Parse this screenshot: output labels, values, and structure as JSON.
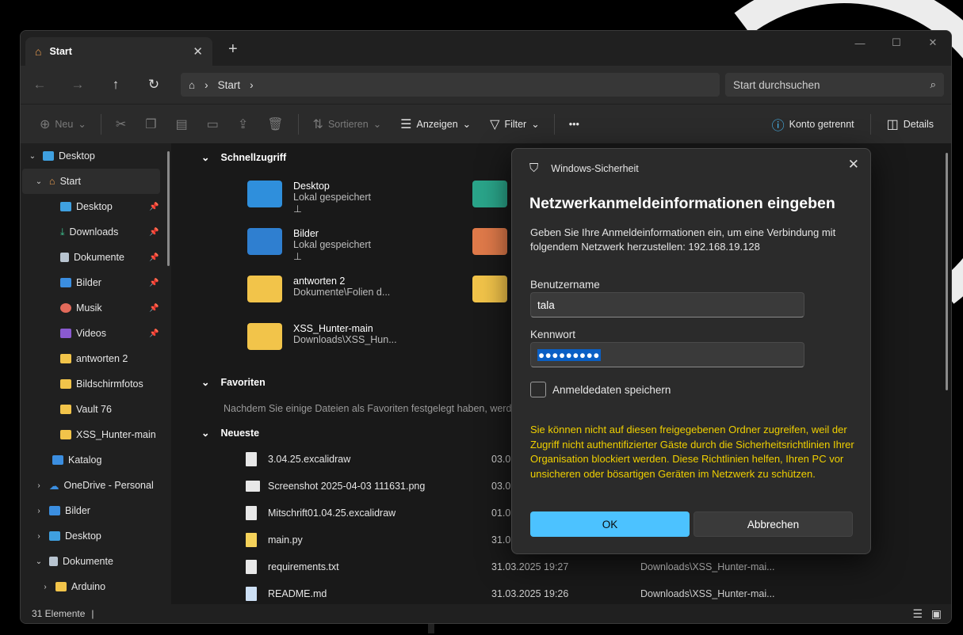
{
  "window": {
    "tab_title": "Start",
    "back_icon": "←",
    "forward_icon": "→",
    "up_icon": "↑",
    "refresh_icon": "↻",
    "breadcrumb": "Start",
    "search_placeholder": "Start durchsuchen"
  },
  "commands": {
    "new": "Neu",
    "sort": "Sortieren",
    "view": "Anzeigen",
    "filter": "Filter",
    "more": "•••",
    "account": "Konto getrennt",
    "details": "Details"
  },
  "sidebar": {
    "items": [
      {
        "label": "Desktop"
      },
      {
        "label": "Start"
      },
      {
        "label": "Desktop"
      },
      {
        "label": "Downloads"
      },
      {
        "label": "Dokumente"
      },
      {
        "label": "Bilder"
      },
      {
        "label": "Musik"
      },
      {
        "label": "Videos"
      },
      {
        "label": "antworten 2"
      },
      {
        "label": "Bildschirmfotos"
      },
      {
        "label": "Vault 76"
      },
      {
        "label": "XSS_Hunter-main"
      },
      {
        "label": "Katalog"
      },
      {
        "label": "OneDrive - Personal"
      },
      {
        "label": "Bilder"
      },
      {
        "label": "Desktop"
      },
      {
        "label": "Dokumente"
      },
      {
        "label": "Arduino"
      }
    ]
  },
  "sections": {
    "quick": "Schnellzugriff",
    "favorites": "Favoriten",
    "favorites_hint": "Nachdem Sie einige Dateien als Favoriten festgelegt haben, werden s",
    "recent": "Neueste"
  },
  "quick_access": [
    {
      "name": "Desktop",
      "sub": "Lokal gespeichert"
    },
    {
      "name": "Bilder",
      "sub": "Lokal gespeichert"
    },
    {
      "name": "antworten 2",
      "sub": "Dokumente\\Folien d..."
    },
    {
      "name": "XSS_Hunter-main",
      "sub": "Downloads\\XSS_Hun..."
    }
  ],
  "recent": [
    {
      "name": "3.04.25.excalidraw",
      "date": "03.0",
      "path": ""
    },
    {
      "name": "Screenshot 2025-04-03 111631.png",
      "date": "03.0",
      "path": ""
    },
    {
      "name": "Mitschrift01.04.25.excalidraw",
      "date": "01.0",
      "path": ""
    },
    {
      "name": "main.py",
      "date": "31.0",
      "path": ""
    },
    {
      "name": "requirements.txt",
      "date": "31.03.2025 19:27",
      "path": "Downloads\\XSS_Hunter-mai..."
    },
    {
      "name": "README.md",
      "date": "31.03.2025 19:26",
      "path": "Downloads\\XSS_Hunter-mai..."
    }
  ],
  "status": {
    "count": "31 Elemente"
  },
  "dialog": {
    "app": "Windows-Sicherheit",
    "title": "Netzwerkanmeldeinformationen eingeben",
    "description": "Geben Sie Ihre Anmeldeinformationen ein, um eine Verbindung mit folgendem Netzwerk herzustellen: 192.168.19.128",
    "user_label": "Benutzername",
    "user_value": "tala",
    "pass_label": "Kennwort",
    "pass_value": "●●●●●●●●●",
    "remember": "Anmeldedaten speichern",
    "warning": "Sie können nicht auf diesen freigegebenen Ordner zugreifen, weil der Zugriff nicht authentifizierter Gäste durch die Sicherheitsrichtlinien Ihrer Organisation blockiert werden. Diese Richtlinien helfen, Ihren PC vor unsicheren oder bösartigen Geräten im Netzwerk zu schützen.",
    "ok": "OK",
    "cancel": "Abbrechen"
  }
}
